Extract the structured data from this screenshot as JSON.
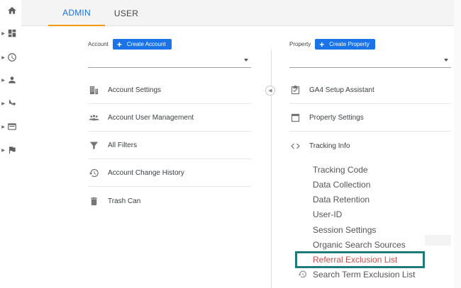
{
  "tabs": {
    "admin": "ADMIN",
    "user": "USER"
  },
  "account": {
    "label": "Account",
    "create_button": "Create Account",
    "items": [
      "Account Settings",
      "Account User Management",
      "All Filters",
      "Account Change History",
      "Trash Can"
    ]
  },
  "property": {
    "label": "Property",
    "create_button": "Create Property",
    "items": [
      "GA4 Setup Assistant",
      "Property Settings",
      "Tracking Info"
    ],
    "tracking_subitems": [
      "Tracking Code",
      "Data Collection",
      "Data Retention",
      "User-ID",
      "Session Settings",
      "Organic Search Sources",
      "Referral Exclusion List",
      "Search Term Exclusion List"
    ]
  },
  "icons": {
    "rail": [
      "home-icon",
      "dashboard-icon",
      "clock-icon",
      "person-icon",
      "acquisition-icon",
      "behavior-icon",
      "flag-icon"
    ]
  },
  "colors": {
    "accent": "#1a73e8",
    "tab_underline": "#f29900",
    "highlight_border": "#1f7a7a",
    "active_link": "#c0504d"
  }
}
